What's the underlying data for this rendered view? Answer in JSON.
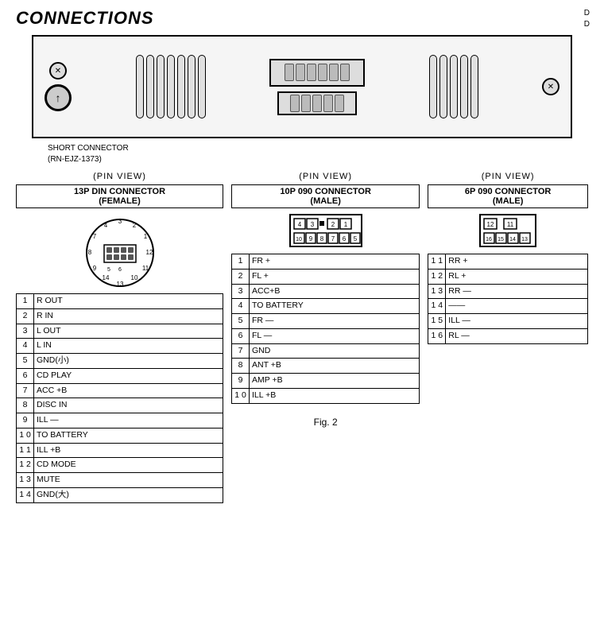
{
  "title": "CONNECTIONS",
  "corner_text": [
    "D",
    "D"
  ],
  "head_unit": {
    "vents_left_count": 7,
    "vents_right_count": 5
  },
  "short_connector_label": {
    "line1": "SHORT CONNECTOR",
    "line2": "(RN-EJZ-1373)"
  },
  "pinview_label": "(PIN  VIEW)",
  "connector13p": {
    "name_line1": "13P DIN CONNECTOR",
    "name_line2": "(FEMALE)",
    "pins": [
      {
        "num": "1",
        "signal": "R OUT"
      },
      {
        "num": "2",
        "signal": "R IN"
      },
      {
        "num": "3",
        "signal": "L OUT"
      },
      {
        "num": "4",
        "signal": "L IN"
      },
      {
        "num": "5",
        "signal": "GND(小)"
      },
      {
        "num": "6",
        "signal": "CD PLAY"
      },
      {
        "num": "7",
        "signal": "ACC +B"
      },
      {
        "num": "8",
        "signal": "DISC IN"
      },
      {
        "num": "9",
        "signal": "ILL —"
      },
      {
        "num": "1 0",
        "signal": "TO BATTERY"
      },
      {
        "num": "1 1",
        "signal": "ILL +B"
      },
      {
        "num": "1 2",
        "signal": "CD MODE"
      },
      {
        "num": "1 3",
        "signal": "MUTE"
      },
      {
        "num": "1 4",
        "signal": "GND(大)"
      }
    ]
  },
  "connector10p": {
    "name_line1": "10P 090 CONNECTOR",
    "name_line2": "(MALE)",
    "top_row_pins": [
      "4",
      "3",
      "",
      "2",
      "1"
    ],
    "bottom_row_pins": [
      "1 0",
      "9",
      "8",
      "7",
      "6",
      "5"
    ],
    "pins": [
      {
        "num": "1",
        "signal": "FR +"
      },
      {
        "num": "2",
        "signal": "FL +"
      },
      {
        "num": "3",
        "signal": "ACC+B"
      },
      {
        "num": "4",
        "signal": "TO BATTERY"
      },
      {
        "num": "5",
        "signal": "FR —"
      },
      {
        "num": "6",
        "signal": "FL —"
      },
      {
        "num": "7",
        "signal": "GND"
      },
      {
        "num": "8",
        "signal": "ANT +B"
      },
      {
        "num": "9",
        "signal": "AMP +B"
      },
      {
        "num": "1 0",
        "signal": "ILL +B"
      }
    ]
  },
  "connector6p": {
    "name_line1": "6P 090 CONNECTOR",
    "name_line2": "(MALE)",
    "top_row_pins": [
      "12",
      "",
      "11"
    ],
    "bottom_row_pins": [
      "16",
      "15",
      "14",
      "13"
    ],
    "pins": [
      {
        "num": "1 1",
        "signal": "RR +"
      },
      {
        "num": "1 2",
        "signal": "RL +"
      },
      {
        "num": "1 3",
        "signal": "RR —"
      },
      {
        "num": "1 4",
        "signal": "——"
      },
      {
        "num": "1 5",
        "signal": "ILL —"
      },
      {
        "num": "1 6",
        "signal": "RL —"
      }
    ]
  },
  "fig_label": "Fig. 2"
}
